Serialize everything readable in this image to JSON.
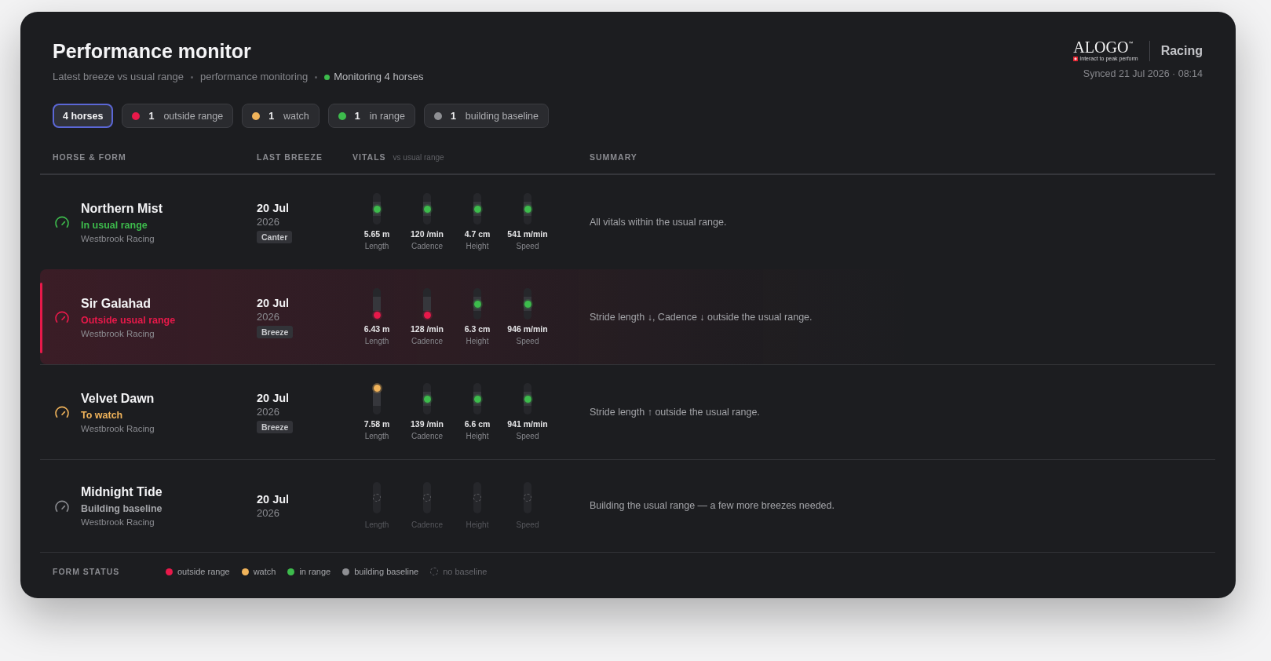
{
  "header": {
    "title": "Performance monitor",
    "subtitle": [
      "Latest breeze vs usual range",
      "performance monitoring"
    ],
    "monitoring": "Monitoring 4 horses"
  },
  "brand": {
    "wordmark": "ALOGO$^{™}$",
    "tagline": "Interact to peak perform",
    "product": "Racing",
    "synced": "Synced 21 Jul 2026 · 08:14"
  },
  "filters": [
    {
      "kind": "all",
      "label": "4 horses",
      "selected": true
    },
    {
      "kind": "status",
      "count": "1",
      "label": "outside range",
      "color": "#e8194a",
      "selected": false
    },
    {
      "kind": "status",
      "count": "1",
      "label": "watch",
      "color": "#f0b35a",
      "selected": false
    },
    {
      "kind": "status",
      "count": "1",
      "label": "in range",
      "color": "#3dbb4c",
      "selected": false
    },
    {
      "kind": "status",
      "count": "1",
      "label": "building baseline",
      "color": "#8e8f93",
      "selected": false
    }
  ],
  "table": {
    "columns": [
      {
        "label": "HORSE & FORM"
      },
      {
        "label": "LAST BREEZE"
      },
      {
        "label": "VITALS",
        "note": "vs usual range"
      },
      {
        "label": "SUMMARY"
      }
    ],
    "rows": [
      {
        "name": "Northern Mist",
        "kind": "normal",
        "status_label": "In usual range",
        "owner": "Westbrook Racing",
        "date": "20 Jul",
        "year": "2026",
        "gait": "Canter",
        "vitals": [
          {
            "value": "5.65 m",
            "label": "Length",
            "kind": "in"
          },
          {
            "value": "120 /min",
            "label": "Cadence",
            "kind": "in"
          },
          {
            "value": "4.7 cm",
            "label": "Height",
            "kind": "in"
          },
          {
            "value": "541 m/min",
            "label": "Speed",
            "kind": "in"
          }
        ],
        "summary": "All vitals within the usual range."
      },
      {
        "name": "Sir Galahad",
        "kind": "alert",
        "status_label": "Outside usual range",
        "owner": "Westbrook Racing",
        "date": "20 Jul",
        "year": "2026",
        "gait": "Breeze",
        "vitals": [
          {
            "value": "6.43 m",
            "label": "Length",
            "kind": "below"
          },
          {
            "value": "128 /min",
            "label": "Cadence",
            "kind": "below"
          },
          {
            "value": "6.3 cm",
            "label": "Height",
            "kind": "in"
          },
          {
            "value": "946 m/min",
            "label": "Speed",
            "kind": "in"
          }
        ],
        "summary": "Stride length ↓, Cadence ↓ outside the usual range."
      },
      {
        "name": "Velvet Dawn",
        "kind": "watch",
        "status_label": "To watch",
        "owner": "Westbrook Racing",
        "date": "20 Jul",
        "year": "2026",
        "gait": "Breeze",
        "vitals": [
          {
            "value": "7.58 m",
            "label": "Length",
            "kind": "above"
          },
          {
            "value": "139 /min",
            "label": "Cadence",
            "kind": "in"
          },
          {
            "value": "6.6 cm",
            "label": "Height",
            "kind": "in"
          },
          {
            "value": "941 m/min",
            "label": "Speed",
            "kind": "in"
          }
        ],
        "summary": "Stride length ↑ outside the usual range."
      },
      {
        "name": "Midnight Tide",
        "kind": "baseline",
        "status_label": "Building baseline",
        "owner": "Westbrook Racing",
        "date": "20 Jul",
        "year": "2026",
        "vitals": [
          {
            "label": "Length",
            "kind": "none"
          },
          {
            "label": "Cadence",
            "kind": "none"
          },
          {
            "label": "Height",
            "kind": "none"
          },
          {
            "label": "Speed",
            "kind": "none"
          }
        ],
        "summary": "Building the usual range — a few more breezes needed."
      }
    ]
  },
  "legend": {
    "title": "FORM STATUS",
    "items": [
      {
        "kind": "dot",
        "label": "outside range",
        "color": "#e8194a"
      },
      {
        "kind": "dot",
        "label": "watch",
        "color": "#f0b35a"
      },
      {
        "kind": "dot",
        "label": "in range",
        "color": "#3dbb4c"
      },
      {
        "kind": "dot",
        "label": "building baseline",
        "color": "#8e8f93"
      },
      {
        "kind": "dashed",
        "label": "no baseline"
      }
    ]
  }
}
